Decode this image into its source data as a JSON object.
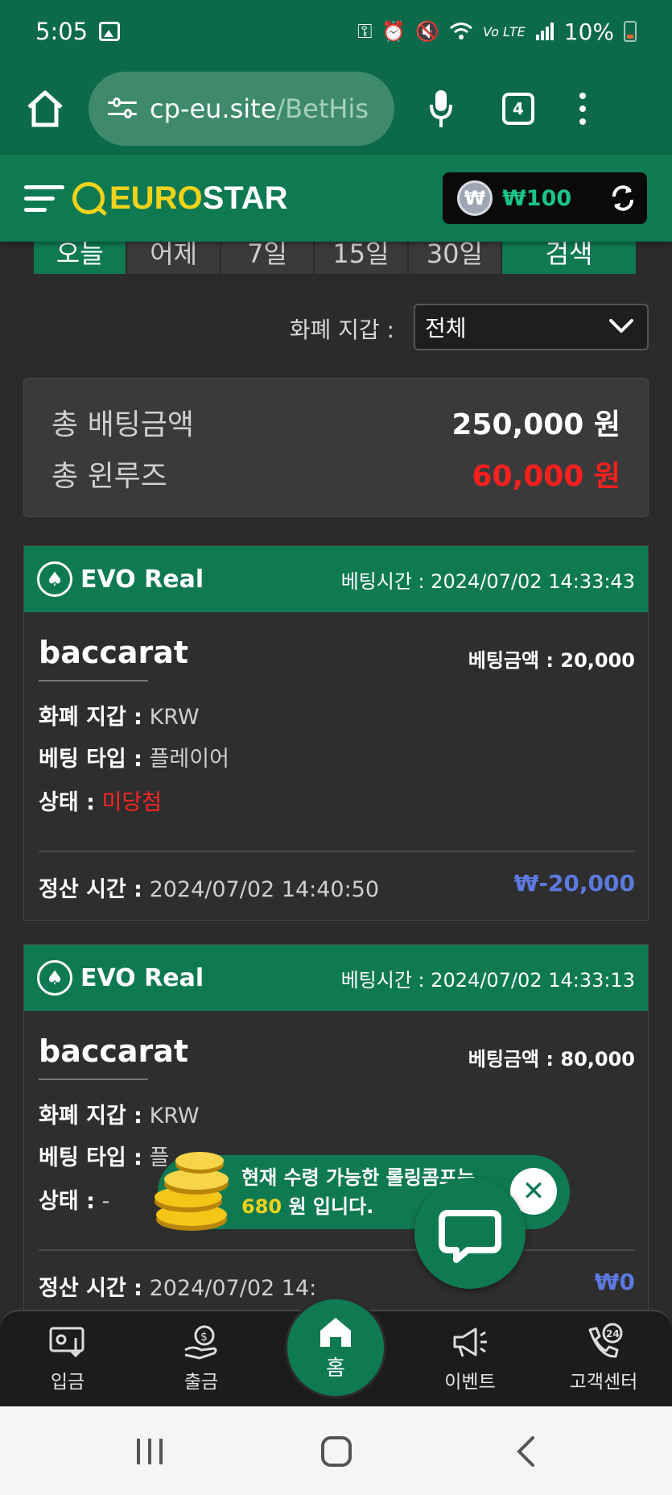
{
  "status_bar": {
    "time": "5:05",
    "battery": "10%",
    "icons": [
      "gallery-icon",
      "vpn-key-icon",
      "alarm-icon",
      "mute-icon",
      "wifi-icon",
      "volte-icon",
      "signal-icon",
      "battery-icon"
    ]
  },
  "browser": {
    "url_host": "cp-eu.site",
    "url_path": "/BetHis",
    "tab_count": "4"
  },
  "header": {
    "logo_part1": "EURO",
    "logo_part2": "STAR",
    "balance_symbol": "₩",
    "balance": "₩100"
  },
  "date_tabs": [
    "오늘",
    "어제",
    "7일",
    "15일",
    "30일"
  ],
  "search_label": "검색",
  "wallet_filter": {
    "label": "화폐 지갑 :",
    "selected": "전체"
  },
  "summary": {
    "total_bet_label": "총 배팅금액",
    "total_bet_value": "250,000 원",
    "total_winloss_label": "총 윈루즈",
    "total_winloss_value": "60,000 원"
  },
  "bets": [
    {
      "provider": "EVO Real",
      "bet_time": "베팅시간 : 2024/07/02 14:33:43",
      "game": "baccarat",
      "bet_amount": "베팅금액 : 20,000",
      "wallet_label": "화폐 지갑 :",
      "wallet_value": "KRW",
      "type_label": "베팅 타입 :",
      "type_value": "플레이어",
      "status_label": "상태 :",
      "status_value": "미당첨",
      "settle_label": "정산 시간 :",
      "settle_value": "2024/07/02 14:40:50",
      "result": "₩-20,000"
    },
    {
      "provider": "EVO Real",
      "bet_time": "베팅시간 : 2024/07/02 14:33:13",
      "game": "baccarat",
      "bet_amount": "베팅금액 : 80,000",
      "wallet_label": "화폐 지갑 :",
      "wallet_value": "KRW",
      "type_label": "베팅 타입 :",
      "type_value": "플",
      "status_label": "상태 :",
      "status_value": "-",
      "settle_label": "정산 시간 :",
      "settle_value": "2024/07/02 14:",
      "result": "₩0"
    }
  ],
  "popup": {
    "line1": "현재 수령 가능한 롤링콤프는",
    "amount": "680",
    "line2_suffix": "원 입니다."
  },
  "bottom_nav": {
    "deposit": "입금",
    "withdraw": "출금",
    "home": "홈",
    "events": "이벤트",
    "support": "고객센터"
  },
  "colors": {
    "brand_green": "#0f7a52",
    "status_green": "#0c6a4a",
    "logo_yellow": "#f2d21a",
    "loss_red": "#ff1f1f",
    "result_blue": "#5d7ae0",
    "balance_green": "#19c48a"
  }
}
